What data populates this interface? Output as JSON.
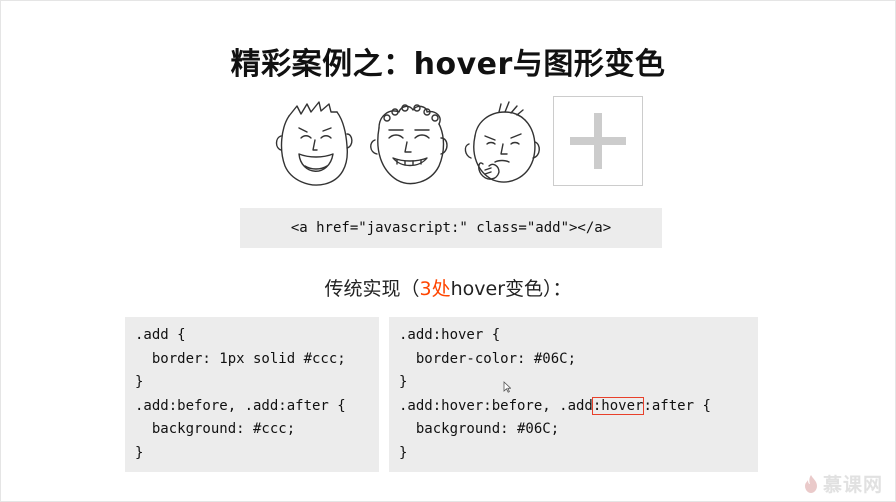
{
  "slide": {
    "title": "精彩案例之：hover与图形变色",
    "snippet": "<a href=\"javascript:\" class=\"add\"></a>",
    "subtitle": {
      "before": "传统实现（",
      "highlight": "3处",
      "after": "hover变色）："
    }
  },
  "code_left": {
    "lines": [
      ".add {",
      "  border: 1px solid #ccc;",
      "}",
      ".add:before, .add:after {",
      "  background: #ccc;",
      "}"
    ]
  },
  "code_right": {
    "lines": [
      ".add:hover {",
      "  border-color: #06C;",
      "}",
      ".add:hover:before, .add:hover:after {",
      "  background: #06C;",
      "}"
    ],
    "boxed_prefix": ".add:hover:before, .add",
    "boxed_text": ":hover",
    "boxed_suffix": ":after {"
  },
  "logo": {
    "text": "慕课网",
    "icon": "flame-icon"
  },
  "colors": {
    "highlight": "#ff4500",
    "code_bg": "#ececec",
    "box_outline": "#e8402a",
    "plus_gray": "#cccccc"
  }
}
